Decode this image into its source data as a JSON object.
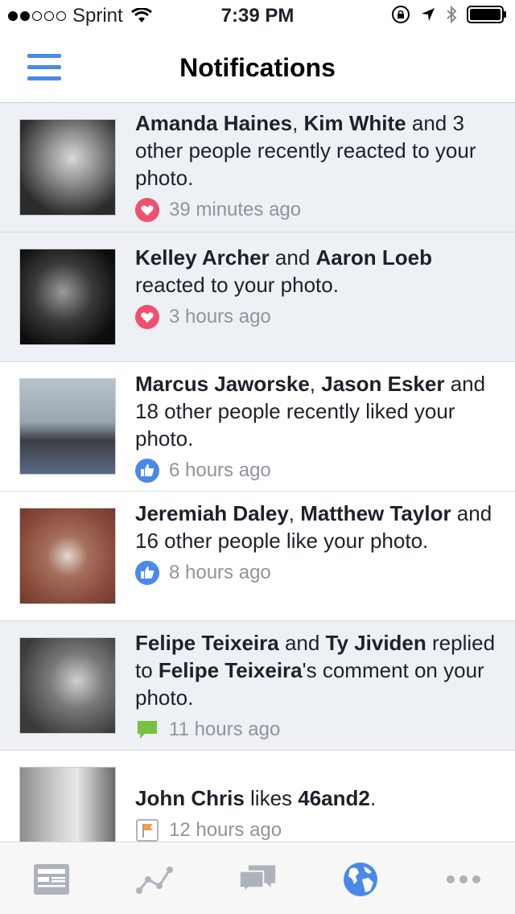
{
  "status_bar": {
    "carrier": "Sprint",
    "time": "7:39 PM"
  },
  "header": {
    "title": "Notifications"
  },
  "notifications": [
    {
      "parts": [
        {
          "text": "Amanda Haines",
          "bold": true
        },
        {
          "text": ", ",
          "bold": false
        },
        {
          "text": "Kim White",
          "bold": true
        },
        {
          "text": " and 3 other people recently reacted to your photo.",
          "bold": false
        }
      ],
      "time": "39 minutes ago",
      "icon": "heart-reaction-icon",
      "unread": true
    },
    {
      "parts": [
        {
          "text": "Kelley Archer",
          "bold": true
        },
        {
          "text": " and ",
          "bold": false
        },
        {
          "text": "Aaron Loeb",
          "bold": true
        },
        {
          "text": " reacted to your photo.",
          "bold": false
        }
      ],
      "time": "3 hours ago",
      "icon": "heart-reaction-icon",
      "unread": true
    },
    {
      "parts": [
        {
          "text": "Marcus Jaworske",
          "bold": true
        },
        {
          "text": ", ",
          "bold": false
        },
        {
          "text": "Jason Esker",
          "bold": true
        },
        {
          "text": " and 18 other people recently liked your photo.",
          "bold": false
        }
      ],
      "time": "6 hours ago",
      "icon": "like-thumb-icon",
      "unread": false
    },
    {
      "parts": [
        {
          "text": "Jeremiah Daley",
          "bold": true
        },
        {
          "text": ", ",
          "bold": false
        },
        {
          "text": "Matthew Taylor",
          "bold": true
        },
        {
          "text": " and 16 other people like your photo.",
          "bold": false
        }
      ],
      "time": "8 hours ago",
      "icon": "like-thumb-icon",
      "unread": false
    },
    {
      "parts": [
        {
          "text": "Felipe Teixeira",
          "bold": true
        },
        {
          "text": " and ",
          "bold": false
        },
        {
          "text": "Ty Jividen",
          "bold": true
        },
        {
          "text": " replied to ",
          "bold": false
        },
        {
          "text": "Felipe Teixeira",
          "bold": true
        },
        {
          "text": "'s comment on your photo.",
          "bold": false
        }
      ],
      "time": "11 hours ago",
      "icon": "comment-bubble-icon",
      "unread": true
    },
    {
      "parts": [
        {
          "text": "John Chris",
          "bold": true
        },
        {
          "text": " likes ",
          "bold": false
        },
        {
          "text": "46and2",
          "bold": true
        },
        {
          "text": ".",
          "bold": false
        }
      ],
      "time": "12 hours ago",
      "icon": "page-flag-icon",
      "unread": false
    }
  ],
  "tab_bar": {
    "tabs": [
      {
        "icon": "news-feed-icon",
        "active": false
      },
      {
        "icon": "activity-chart-icon",
        "active": false
      },
      {
        "icon": "messages-icon",
        "active": false
      },
      {
        "icon": "globe-notifications-icon",
        "active": true
      },
      {
        "icon": "more-dots-icon",
        "active": false
      }
    ]
  },
  "colors": {
    "accent": "#4a89e8",
    "unread_bg": "#edf0f5",
    "heart": "#f0506e",
    "like": "#4a89e8",
    "comment": "#7ac142",
    "flag": "#f6a04d",
    "meta_text": "#90949c"
  }
}
